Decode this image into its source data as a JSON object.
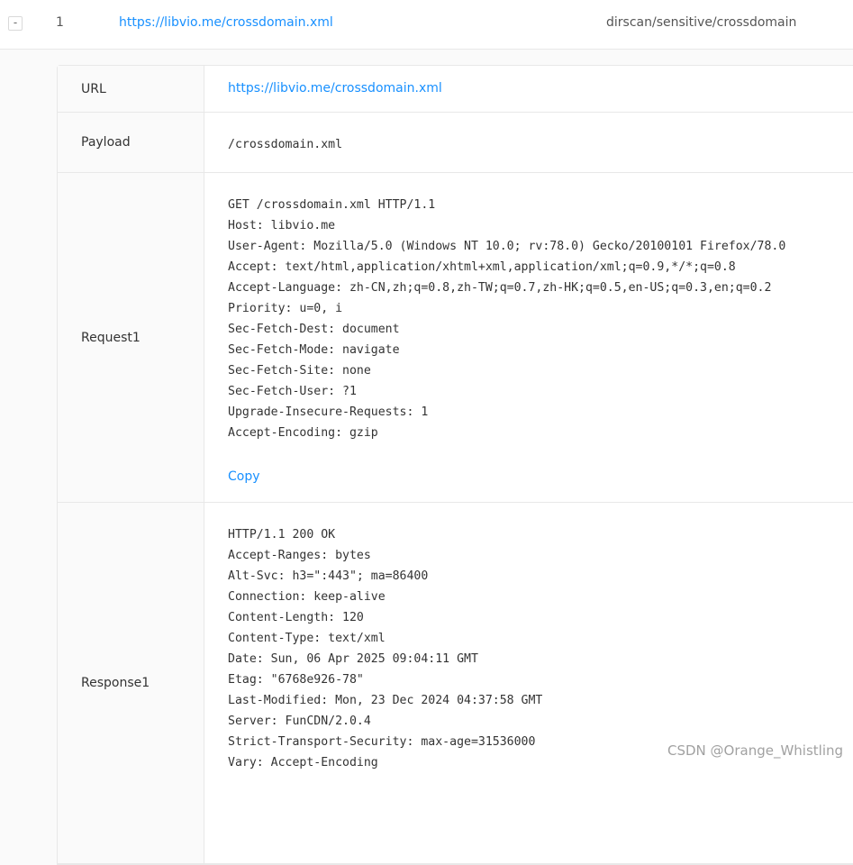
{
  "row": {
    "expand_symbol": "-",
    "index": "1",
    "url": "https://libvio.me/crossdomain.xml",
    "plugin": "dirscan/sensitive/crossdomain"
  },
  "detail": {
    "url_label": "URL",
    "url_value": "https://libvio.me/crossdomain.xml",
    "payload_label": "Payload",
    "payload_value": "/crossdomain.xml",
    "request_label": "Request1",
    "request_lines": [
      "GET /crossdomain.xml HTTP/1.1",
      "Host: libvio.me",
      "User-Agent: Mozilla/5.0 (Windows NT 10.0; rv:78.0) Gecko/20100101 Firefox/78.0",
      "Accept: text/html,application/xhtml+xml,application/xml;q=0.9,*/*;q=0.8",
      "Accept-Language: zh-CN,zh;q=0.8,zh-TW;q=0.7,zh-HK;q=0.5,en-US;q=0.3,en;q=0.2",
      "Priority: u=0, i",
      "Sec-Fetch-Dest: document",
      "Sec-Fetch-Mode: navigate",
      "Sec-Fetch-Site: none",
      "Sec-Fetch-User: ?1",
      "Upgrade-Insecure-Requests: 1",
      "Accept-Encoding: gzip"
    ],
    "copy_label": "Copy",
    "response_label": "Response1",
    "response_lines": [
      "HTTP/1.1 200 OK",
      "Accept-Ranges: bytes",
      "Alt-Svc: h3=\":443\"; ma=86400",
      "Connection: keep-alive",
      "Content-Length: 120",
      "Content-Type: text/xml",
      "Date: Sun, 06 Apr 2025 09:04:11 GMT",
      "Etag: \"6768e926-78\"",
      "Last-Modified: Mon, 23 Dec 2024 04:37:58 GMT",
      "Server: FunCDN/2.0.4",
      "Strict-Transport-Security: max-age=31536000",
      "Vary: Accept-Encoding"
    ]
  },
  "watermark": "CSDN @Orange_Whistling",
  "colors": {
    "link": "#1890ff",
    "border": "#e8e8e8",
    "label_bg": "#fafafa"
  }
}
